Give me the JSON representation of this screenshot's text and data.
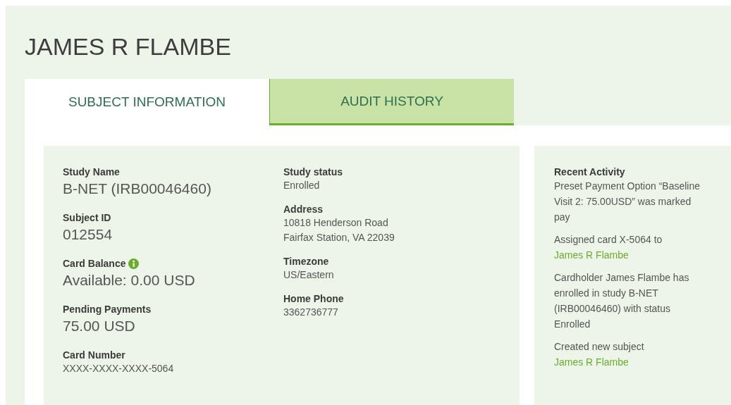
{
  "title": "JAMES R FLAMBE",
  "tabs": [
    {
      "label": "SUBJECT INFORMATION",
      "selected": true
    },
    {
      "label": "AUDIT HISTORY",
      "selected": false
    }
  ],
  "subject_columns": [
    {
      "fields": [
        {
          "label": "Study Name",
          "kind": "large",
          "value": [
            "B-NET (IRB00046460)"
          ]
        },
        {
          "label": "Subject ID",
          "kind": "large",
          "value": [
            "012554"
          ]
        },
        {
          "label": "Card Balance",
          "kind": "large",
          "info": true,
          "value": [
            "Available: 0.00 USD"
          ]
        },
        {
          "label": "Pending Payments",
          "kind": "large",
          "value": [
            "75.00 USD"
          ]
        },
        {
          "label": "Card Number",
          "kind": "small",
          "value": [
            "XXXX-XXXX-XXXX-5064"
          ]
        }
      ]
    },
    {
      "fields": [
        {
          "label": "Study status",
          "kind": "small",
          "value": [
            "Enrolled"
          ]
        },
        {
          "label": "Address",
          "kind": "small",
          "value": [
            "10818 Henderson Road",
            "Fairfax Station, VA 22039"
          ]
        },
        {
          "label": "Timezone",
          "kind": "small",
          "value": [
            "US/Eastern"
          ]
        },
        {
          "label": "Home Phone",
          "kind": "small",
          "value": [
            "3362736777"
          ]
        }
      ]
    }
  ],
  "recent_activity": {
    "heading": "Recent Activity",
    "items": [
      {
        "text": "Preset Payment Option “Baseline Visit 2: 75.00USD” was marked pay"
      },
      {
        "text": "Assigned card X-5064 to ",
        "link": "James R Flambe"
      },
      {
        "text": "Cardholder James Flambe has enrolled in study B-NET (IRB00046460) with status Enrolled"
      },
      {
        "text": "Created new subject ",
        "link": "James R Flambe"
      }
    ]
  }
}
